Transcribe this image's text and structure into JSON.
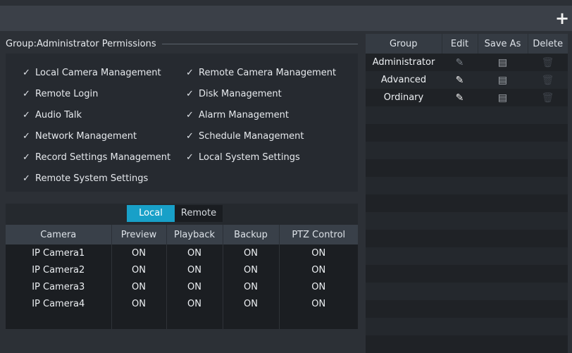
{
  "toolbar": {
    "add_icon": "plus-icon"
  },
  "permissions": {
    "title": "Group:Administrator Permissions",
    "check_glyph": "✓",
    "items": [
      "Local Camera Management",
      "Remote Camera Management",
      "Remote Login",
      "Disk Management",
      "Audio Talk",
      "Alarm Management",
      "Network Management",
      "Schedule Management",
      "Record Settings Management",
      "Local System Settings",
      "Remote System Settings"
    ]
  },
  "channel": {
    "tabs": [
      {
        "label": "Local",
        "active": true
      },
      {
        "label": "Remote",
        "active": false
      }
    ],
    "columns": [
      "Camera",
      "Preview",
      "Playback",
      "Backup",
      "PTZ Control"
    ],
    "rows": [
      [
        "IP Camera1",
        "ON",
        "ON",
        "ON",
        "ON"
      ],
      [
        "IP Camera2",
        "ON",
        "ON",
        "ON",
        "ON"
      ],
      [
        "IP Camera3",
        "ON",
        "ON",
        "ON",
        "ON"
      ],
      [
        "IP Camera4",
        "ON",
        "ON",
        "ON",
        "ON"
      ]
    ]
  },
  "groups": {
    "columns": [
      "Group",
      "Edit",
      "Save As",
      "Delete"
    ],
    "rows": [
      {
        "name": "Administrator",
        "edit_icon": "pencil-icon",
        "save_icon": "floppy-disk-icon",
        "delete_icon": "trash-icon",
        "editable": false,
        "deletable": false
      },
      {
        "name": "Advanced",
        "edit_icon": "pencil-icon",
        "save_icon": "floppy-disk-icon",
        "delete_icon": "trash-icon",
        "editable": true,
        "deletable": false
      },
      {
        "name": "Ordinary",
        "edit_icon": "pencil-icon",
        "save_icon": "floppy-disk-icon",
        "delete_icon": "trash-icon",
        "editable": true,
        "deletable": false
      }
    ]
  },
  "colors": {
    "accent": "#18a0c8",
    "background": "#2c3036",
    "header": "#394049"
  }
}
